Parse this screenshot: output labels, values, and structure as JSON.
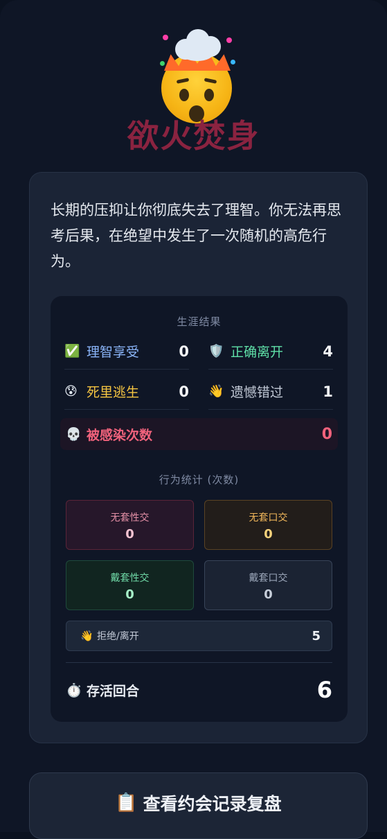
{
  "header": {
    "icon": "exploding-head-icon",
    "title": "欲火焚身"
  },
  "card": {
    "description": "长期的压抑让你彻底失去了理智。你无法再思考后果，在绝望中发生了一次随机的高危行为。"
  },
  "career": {
    "title": "生涯结果",
    "stats": [
      {
        "icon": "✅",
        "label": "理智享受",
        "value": "0",
        "color": "#8ab4f8"
      },
      {
        "icon": "🛡️",
        "label": "正确离开",
        "value": "4",
        "color": "#5fe0a8"
      },
      {
        "icon": "😰",
        "label": "死里逃生",
        "value": "0",
        "color": "#f5c542"
      },
      {
        "icon": "👋",
        "label": "遗憾错过",
        "value": "1",
        "color": "#c2c9d6"
      }
    ],
    "infected": {
      "icon": "💀",
      "label": "被感染次数",
      "value": "0"
    }
  },
  "behavior": {
    "title": "行为统计 (次数)",
    "boxes": [
      {
        "label": "无套性交",
        "value": "0"
      },
      {
        "label": "无套口交",
        "value": "0"
      },
      {
        "label": "戴套性交",
        "value": "0"
      },
      {
        "label": "戴套口交",
        "value": "0"
      }
    ],
    "reject": {
      "icon": "👋",
      "label": "拒绝/离开",
      "value": "5"
    }
  },
  "survival": {
    "icon": "⏱️",
    "label": "存活回合",
    "value": "6"
  },
  "review_button": {
    "icon": "📋",
    "label": "查看约会记录复盘"
  },
  "colors": {
    "title": "#8a2340",
    "danger": "#f0627c",
    "accent_green": "#5fe0a8",
    "accent_blue": "#8ab4f8",
    "accent_yellow": "#f5c542"
  }
}
